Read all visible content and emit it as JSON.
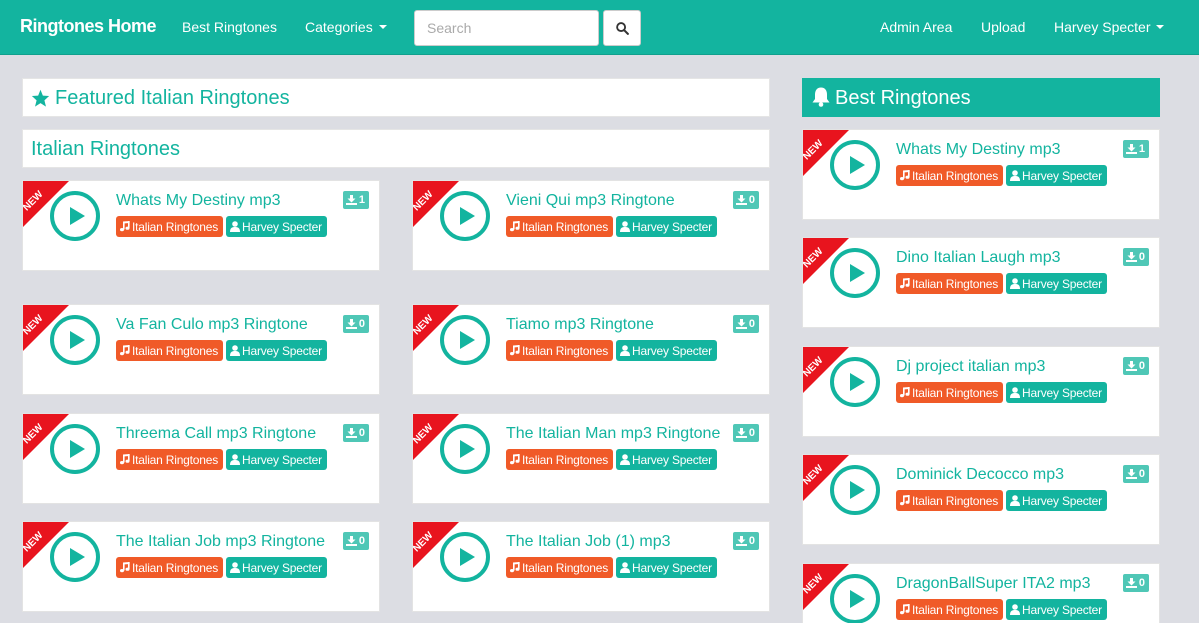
{
  "nav": {
    "brand": "Ringtones Home",
    "best_ringtones": "Best Ringtones",
    "categories": "Categories",
    "search_placeholder": "Search",
    "admin_area": "Admin Area",
    "upload": "Upload",
    "user": "Harvey Specter"
  },
  "featured": {
    "title": "Featured Italian Ringtones"
  },
  "category": {
    "title": "Italian Ringtones"
  },
  "best": {
    "title": "Best Ringtones"
  },
  "ribbon_label": "NEW",
  "ringtones": [
    {
      "title": "Whats My Destiny mp3",
      "downloads": "1",
      "category": "Italian Ringtones",
      "user": "Harvey Specter"
    },
    {
      "title": "Vieni Qui mp3 Ringtone",
      "downloads": "0",
      "category": "Italian Ringtones",
      "user": "Harvey Specter"
    },
    {
      "title": "Va Fan Culo mp3 Ringtone",
      "downloads": "0",
      "category": "Italian Ringtones",
      "user": "Harvey Specter"
    },
    {
      "title": "Tiamo mp3 Ringtone",
      "downloads": "0",
      "category": "Italian Ringtones",
      "user": "Harvey Specter"
    },
    {
      "title": "Threema Call mp3 Ringtone",
      "downloads": "0",
      "category": "Italian Ringtones",
      "user": "Harvey Specter"
    },
    {
      "title": "The Italian Man mp3 Ringtone",
      "downloads": "0",
      "category": "Italian Ringtones",
      "user": "Harvey Specter"
    },
    {
      "title": "The Italian Job mp3 Ringtone",
      "downloads": "0",
      "category": "Italian Ringtones",
      "user": "Harvey Specter"
    },
    {
      "title": "The Italian Job (1) mp3",
      "downloads": "0",
      "category": "Italian Ringtones",
      "user": "Harvey Specter"
    }
  ],
  "best_ringtones": [
    {
      "title": "Whats My Destiny mp3",
      "downloads": "1",
      "category": "Italian Ringtones",
      "user": "Harvey Specter"
    },
    {
      "title": "Dino Italian Laugh mp3",
      "downloads": "0",
      "category": "Italian Ringtones",
      "user": "Harvey Specter"
    },
    {
      "title": "Dj project italian mp3",
      "downloads": "0",
      "category": "Italian Ringtones",
      "user": "Harvey Specter"
    },
    {
      "title": "Dominick Decocco mp3",
      "downloads": "0",
      "category": "Italian Ringtones",
      "user": "Harvey Specter"
    },
    {
      "title": "DragonBallSuper ITA2 mp3",
      "downloads": "0",
      "category": "Italian Ringtones",
      "user": "Harvey Specter"
    }
  ],
  "colors": {
    "primary": "#13b49f",
    "category_tag": "#f05a28",
    "ribbon": "#e8141e",
    "background": "#dcdde3"
  }
}
